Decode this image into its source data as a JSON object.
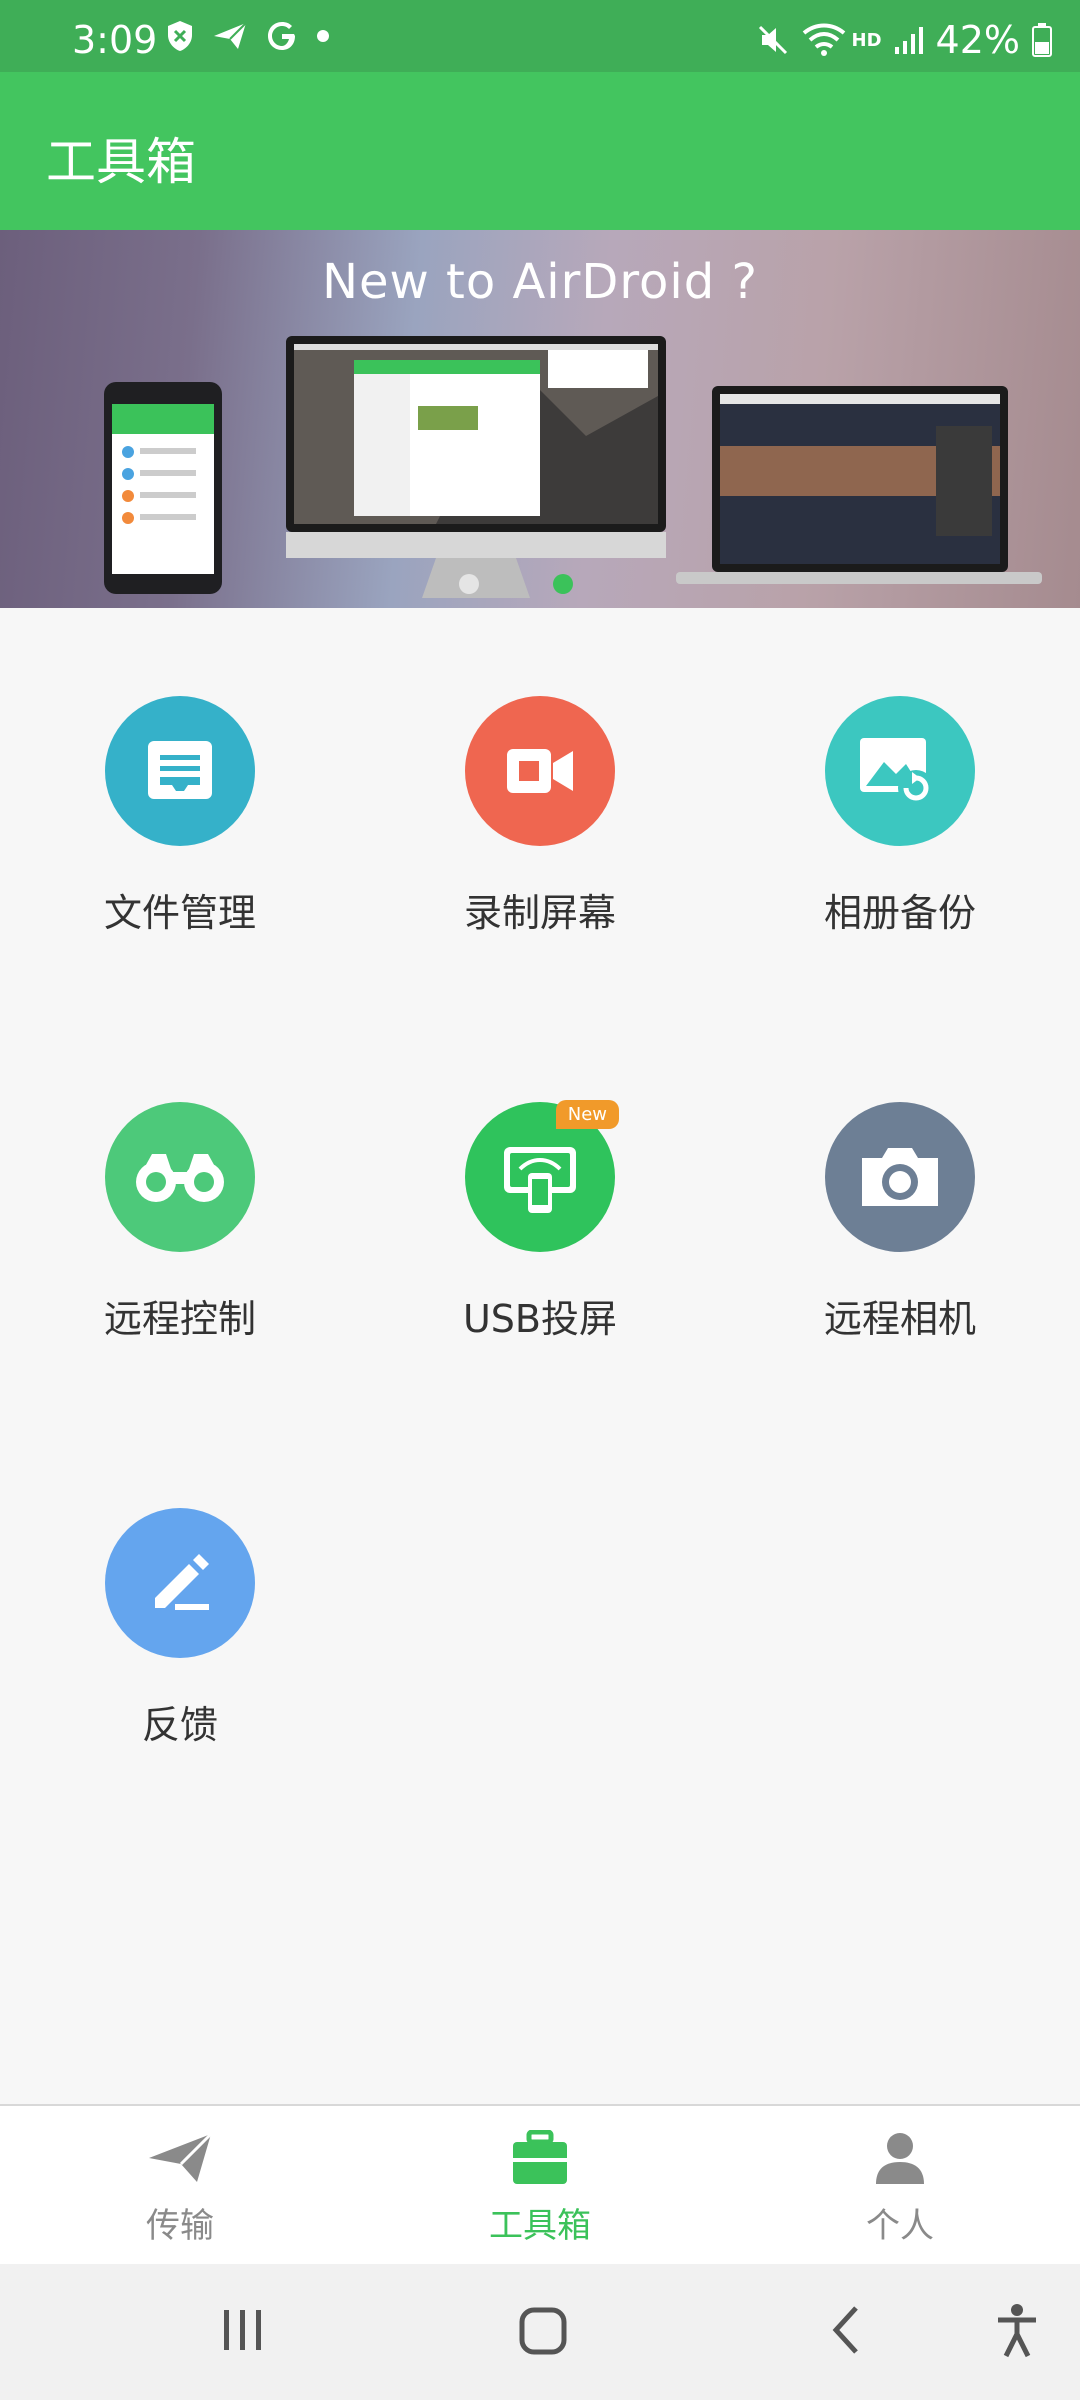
{
  "status_bar": {
    "time": "3:09",
    "battery": "42%",
    "hd_label": "HD",
    "left_icons": [
      "shield-icon",
      "send-icon",
      "google-icon",
      "dot-icon"
    ],
    "right_icons": [
      "mute-icon",
      "wifi-icon",
      "signal-icon",
      "battery-icon"
    ]
  },
  "app_bar": {
    "title": "工具箱",
    "color": "#43c55f"
  },
  "banner": {
    "title": "New to AirDroid ?",
    "active_dot": 2
  },
  "tools": [
    {
      "label": "文件管理",
      "icon": "file-manager-icon",
      "color": "#35b1c9"
    },
    {
      "label": "录制屏幕",
      "icon": "screen-record-icon",
      "color": "#ef6650"
    },
    {
      "label": "相册备份",
      "icon": "photo-backup-icon",
      "color": "#3cc7c0"
    },
    {
      "label": "远程控制",
      "icon": "binoculars-icon",
      "color": "#4dc97a"
    },
    {
      "label": "USB投屏",
      "icon": "usb-cast-icon",
      "color": "#2fc35c",
      "badge": "New"
    },
    {
      "label": "远程相机",
      "icon": "camera-icon",
      "color": "#6d7f95"
    },
    {
      "label": "反馈",
      "icon": "feedback-pen-icon",
      "color": "#64a5ee"
    }
  ],
  "bottom_nav": [
    {
      "label": "传输",
      "icon": "paper-plane-icon",
      "active": false
    },
    {
      "label": "工具箱",
      "icon": "toolbox-icon",
      "active": true
    },
    {
      "label": "个人",
      "icon": "person-icon",
      "active": false
    }
  ],
  "system_nav": [
    "recents-icon",
    "home-icon",
    "back-icon",
    "accessibility-icon"
  ]
}
